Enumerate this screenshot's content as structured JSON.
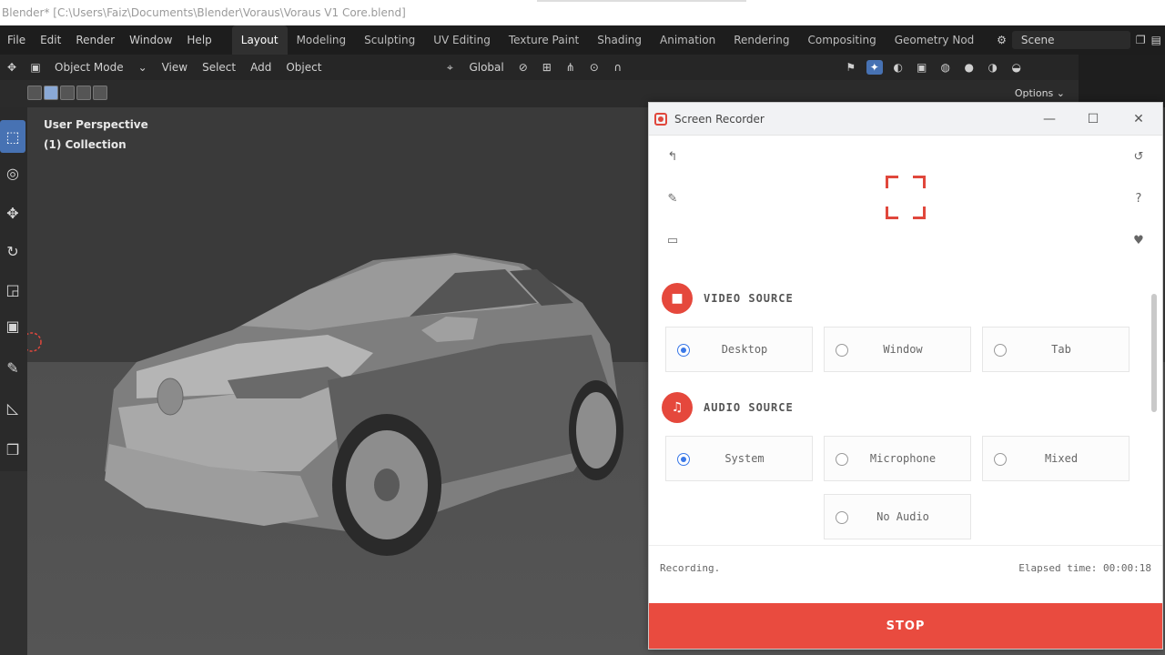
{
  "window_title": "Blender* [C:\\Users\\Faiz\\Documents\\Blender\\Voraus\\Voraus V1 Core.blend]",
  "menubar": {
    "menus": [
      "File",
      "Edit",
      "Render",
      "Window",
      "Help"
    ],
    "workspaces": [
      "Layout",
      "Modeling",
      "Sculpting",
      "UV Editing",
      "Texture Paint",
      "Shading",
      "Animation",
      "Rendering",
      "Compositing",
      "Geometry Nod"
    ],
    "active_workspace": "Layout",
    "scene": "Scene"
  },
  "header": {
    "mode": "Object Mode",
    "menus": [
      "View",
      "Select",
      "Add",
      "Object"
    ],
    "orientation": "Global",
    "options": "Options"
  },
  "viewport": {
    "perspective": "User Perspective",
    "collection": "(1) Collection"
  },
  "recorder": {
    "title": "Screen Recorder",
    "video_source": {
      "label": "VIDEO SOURCE",
      "options": [
        "Desktop",
        "Window",
        "Tab"
      ],
      "selected": "Desktop"
    },
    "audio_source": {
      "label": "AUDIO SOURCE",
      "options": [
        "System",
        "Microphone",
        "Mixed",
        "No Audio"
      ],
      "selected": "System"
    },
    "status": "Recording.",
    "elapsed": "Elapsed time: 00:00:18",
    "stop_label": "STOP",
    "accent_color": "#e94b3f",
    "radio_color": "#3a78e7"
  }
}
